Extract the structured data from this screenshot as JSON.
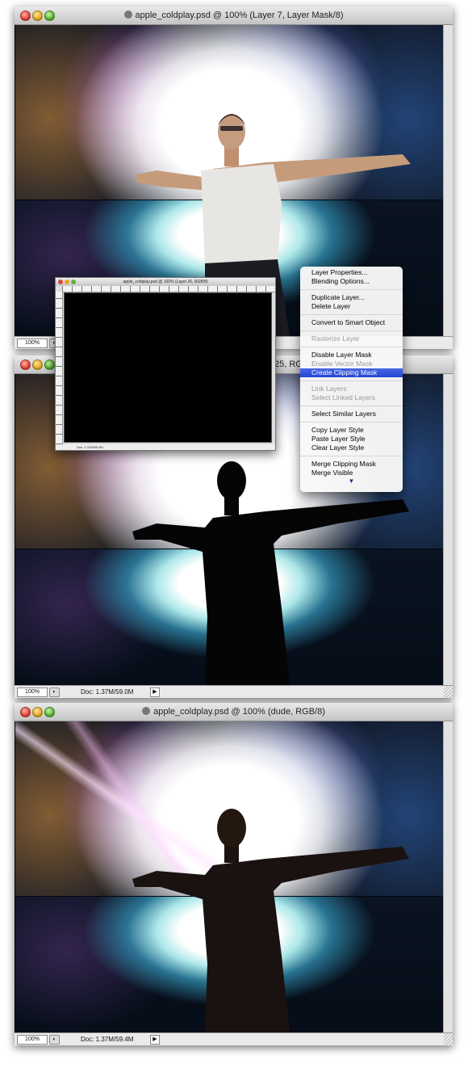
{
  "windows": [
    {
      "title": "apple_coldplay.psd @ 100% (Layer 7, Layer Mask/8)",
      "zoom": "100%",
      "docinfo": ""
    },
    {
      "title": "25, RGB/8)",
      "zoom": "100%",
      "docinfo": "Doc: 1.37M/59.0M"
    },
    {
      "title": "apple_coldplay.psd @ 100% (dude, RGB/8)",
      "zoom": "100%",
      "docinfo": "Doc: 1.37M/59.4M"
    }
  ],
  "mini_window": {
    "title": "apple_coldplay.psd @ 100% (Layer 26, RGB/8)",
    "docinfo": "Doc: 1.37M/59.4M"
  },
  "context_menu": {
    "groups": [
      [
        {
          "label": "Layer Properties..."
        },
        {
          "label": "Blending Options..."
        }
      ],
      [
        {
          "label": "Duplicate Layer..."
        },
        {
          "label": "Delete Layer"
        }
      ],
      [
        {
          "label": "Convert to Smart Object"
        }
      ],
      [
        {
          "label": "Rasterize Layer",
          "disabled": true
        }
      ],
      [
        {
          "label": "Disable Layer Mask"
        },
        {
          "label": "Enable Vector Mask",
          "disabled": true
        },
        {
          "label": "Create Clipping Mask",
          "highlighted": true
        }
      ],
      [
        {
          "label": "Link Layers",
          "disabled": true
        },
        {
          "label": "Select Linked Layers",
          "disabled": true
        }
      ],
      [
        {
          "label": "Select Similar Layers"
        }
      ],
      [
        {
          "label": "Copy Layer Style"
        },
        {
          "label": "Paste Layer Style"
        },
        {
          "label": "Clear Layer Style"
        }
      ],
      [
        {
          "label": "Merge Clipping Mask"
        },
        {
          "label": "Merge Visible"
        }
      ]
    ],
    "more_glyph": "▼"
  },
  "icons": {
    "status": "◐",
    "arrow": "▶"
  }
}
